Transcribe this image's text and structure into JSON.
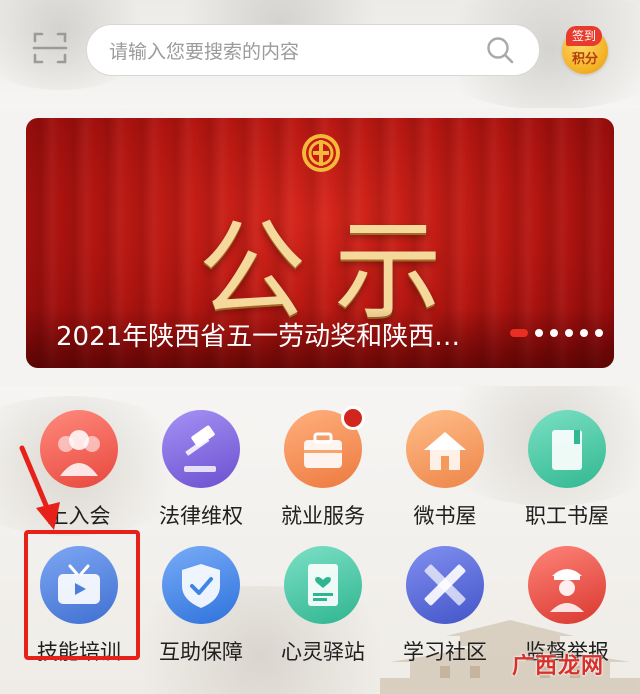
{
  "header": {
    "search_placeholder": "请输入您要搜索的内容",
    "signin_badge": "签到",
    "points_label": "积分"
  },
  "banner": {
    "big_text": "公示",
    "title": "2021年陕西省五一劳动奖和陕西…",
    "slide_count": 6,
    "active_slide": 0
  },
  "grid": {
    "items": [
      {
        "label": "上入会",
        "icon": "join-union-icon",
        "color": "#ec5a50"
      },
      {
        "label": "法律维权",
        "icon": "gavel-icon",
        "color": "#7b64d8"
      },
      {
        "label": "就业服务",
        "icon": "briefcase-icon",
        "color": "#f08a4b",
        "badge": true
      },
      {
        "label": "微书屋",
        "icon": "house-icon",
        "color": "#f2914f"
      },
      {
        "label": "职工书屋",
        "icon": "book-icon",
        "color": "#3fc6a4"
      },
      {
        "label": "技能培训",
        "icon": "tv-icon",
        "color": "#4a7fdc"
      },
      {
        "label": "互助保障",
        "icon": "shield-check-icon",
        "color": "#3f84e6"
      },
      {
        "label": "心灵驿站",
        "icon": "heart-note-icon",
        "color": "#3dbfa0"
      },
      {
        "label": "学习社区",
        "icon": "ruler-pencil-icon",
        "color": "#5668d6"
      },
      {
        "label": "监督举报",
        "icon": "inspector-icon",
        "color": "#e1463d"
      }
    ]
  },
  "watermark": "广西龙网",
  "colors": {
    "accent_red": "#e8201a",
    "banner_red": "#b31510",
    "gold": "#f5d99c"
  }
}
